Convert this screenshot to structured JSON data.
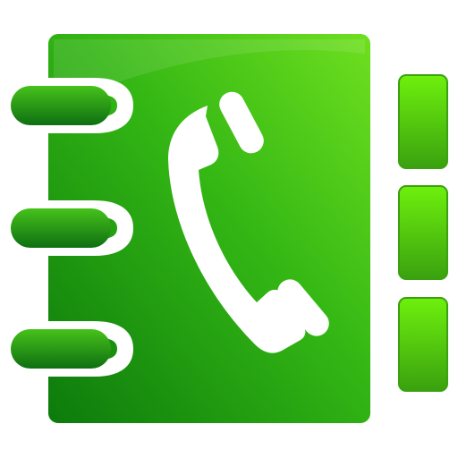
{
  "icon": {
    "name": "phone-book-icon",
    "colors": {
      "book_light": "#6fe01f",
      "book_mid": "#33b614",
      "book_dark": "#0c7a0c",
      "rings_light": "#46c21a",
      "rings_dark": "#0e6f12",
      "tabs": "#6ef00d",
      "tabs_edge": "#3aa10f",
      "handset": "#ffffff",
      "outline": "#ffffff"
    },
    "tabs_count": 3,
    "rings_count": 3
  }
}
